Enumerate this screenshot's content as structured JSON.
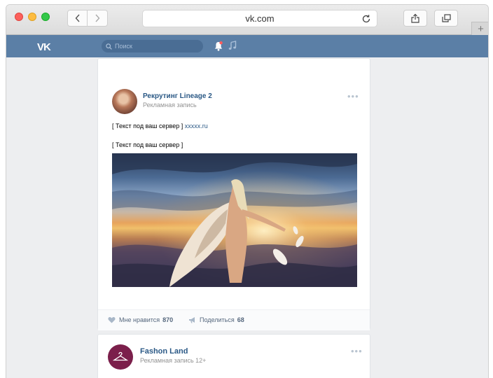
{
  "browser": {
    "url": "vk.com",
    "newtab_symbol": "+"
  },
  "header": {
    "logo": "VK",
    "search_placeholder": "Поиск",
    "color": "#5b7fa6"
  },
  "posts": [
    {
      "author": "Рекрутинг Lineage 2",
      "subtitle": "Рекламная запись",
      "text_line_1_prefix": "[ Текст под ваш сервер ]",
      "text_line_1_link": "xxxxx.ru",
      "text_line_2": "[ Текст под ваш сервер ]",
      "like_label": "Мне нравится",
      "like_count": "870",
      "share_label": "Поделиться",
      "share_count": "68"
    },
    {
      "author": "Fashon Land",
      "subtitle": "Рекламная запись 12+"
    }
  ],
  "colors": {
    "link": "#2a5885",
    "muted": "#939393"
  }
}
